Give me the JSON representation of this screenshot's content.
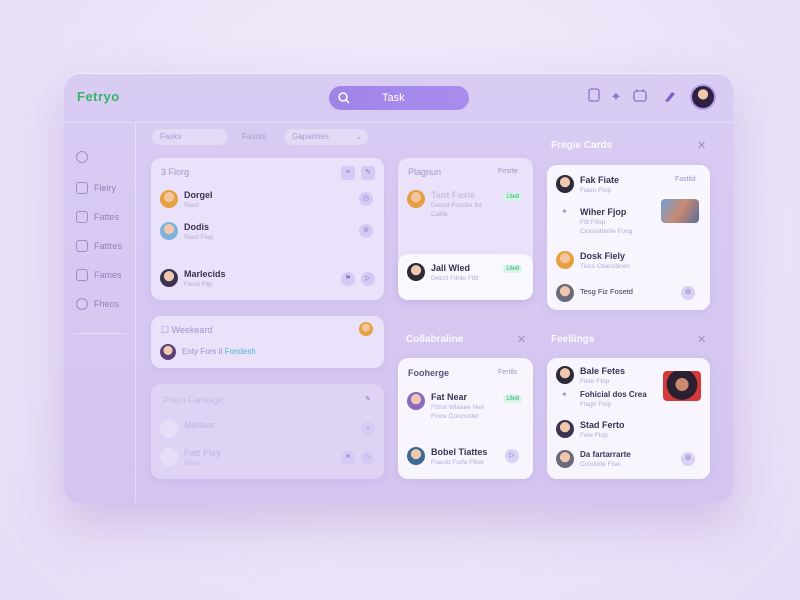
{
  "app": {
    "logo": "Fetryo"
  },
  "search": {
    "label": "Task"
  },
  "topbar": {
    "icons": [
      "document-icon",
      "sparkle-icon",
      "calendar-icon",
      "brush-icon"
    ]
  },
  "sidebar": {
    "items": [
      {
        "label": "",
        "icon": "chat-icon"
      },
      {
        "label": "Fleiry",
        "icon": "home-icon"
      },
      {
        "label": "Fattes",
        "icon": "folder-icon"
      },
      {
        "label": "Fattres",
        "icon": "grid-icon"
      },
      {
        "label": "Fames",
        "icon": "calendar-icon"
      },
      {
        "label": "Fheos",
        "icon": "clock-icon"
      }
    ]
  },
  "filters": [
    "Fasks",
    "Fasnts",
    "Gaparines"
  ],
  "card_tasks": {
    "title": "3 Fiorg",
    "rows": [
      {
        "name": "Dorgel",
        "sub": "Riest"
      },
      {
        "name": "Dodis",
        "sub": "Riest Fiap"
      },
      {
        "name": "Marlecids",
        "sub": "Fiesd Fitp"
      }
    ]
  },
  "card_weekend": {
    "title": "Weekeard",
    "row": "Enty Fors it",
    "link": "Fondesh"
  },
  "card_project": {
    "title": "Prejci Fanasge",
    "rows": [
      {
        "name": "Mellaar"
      },
      {
        "name": "Fatt Fley",
        "sub": "Riest"
      }
    ]
  },
  "card_plan": {
    "title": "Plagnun",
    "link": "Fesrte",
    "rows": [
      {
        "name": "Taot Fasle",
        "sub": "Decsd Foocke for",
        "sub2": "Catlie",
        "badge": "18e8"
      },
      {
        "name": "Jall Wled",
        "sub": "Detcrt Fitnle Fittl",
        "badge": "18e8"
      }
    ]
  },
  "card_projectcards": {
    "section": "Fregie Cards",
    "link": "Fastild",
    "rows": [
      {
        "name": "Fak Fiate",
        "sub": "Fiaen Ftop"
      },
      {
        "name": "Wiher Fjop",
        "sub": "Fitt Fifop",
        "sub2": "Ciocestterlie Foog"
      },
      {
        "name": "Dosk Fiely",
        "sub": "Tiscs Ctiarodinen"
      },
      {
        "name": "Tesg Fiz Fosetd"
      }
    ]
  },
  "card_collab": {
    "section": "Collabraline",
    "title": "Fooherge",
    "link": "Fertils",
    "rows": [
      {
        "name": "Fat Near",
        "sub": "Fltnst Wlaaee Nerl",
        "sub2": "Fioce Concorder",
        "badge": "18e8"
      },
      {
        "name": "Bobel Tiattes",
        "sub": "Fiaestt Forfe Ffioe"
      }
    ]
  },
  "card_feelings": {
    "section": "Feellings",
    "rows": [
      {
        "name": "Bale Fetes",
        "sub": "Flete Ftop"
      },
      {
        "name": "Fohicial dos Crea",
        "sub": "Flagtr Ftop"
      },
      {
        "name": "Stad Ferto",
        "sub": "Fete Ftop"
      },
      {
        "name": "Da fartarrarte",
        "sub": "Ccodinte Fise"
      }
    ]
  },
  "colors": {
    "accent": "#a98ded",
    "logo": "#39b36a",
    "badge": "#2fb574"
  }
}
